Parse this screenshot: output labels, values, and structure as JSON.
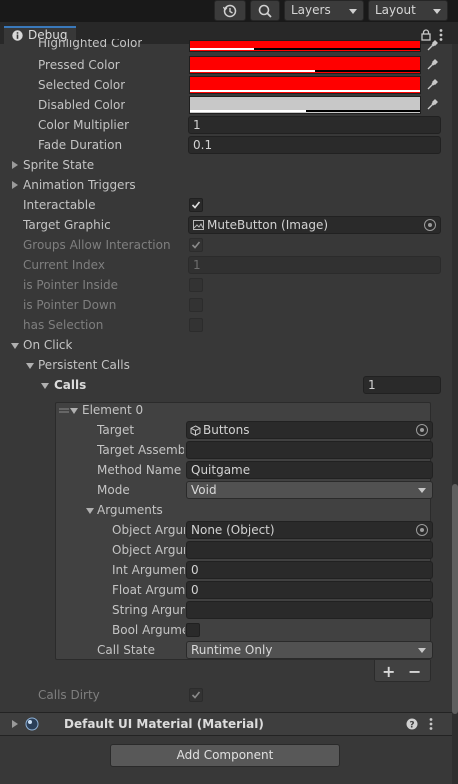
{
  "toolbar": {
    "layers_label": "Layers",
    "layout_label": "Layout"
  },
  "tab": {
    "title": "Debug"
  },
  "colors": {
    "pressed": "#ff0000",
    "selected": "#ff0000",
    "highlighted": "#ff0000",
    "disabled": "#c8c8c8",
    "accent": "#3a79bb"
  },
  "fields": {
    "highlighted_color": "Highlighted Color",
    "pressed_color": "Pressed Color",
    "selected_color": "Selected Color",
    "disabled_color": "Disabled Color",
    "color_multiplier_label": "Color Multiplier",
    "color_multiplier_value": "1",
    "fade_duration_label": "Fade Duration",
    "fade_duration_value": "0.1",
    "sprite_state": "Sprite State",
    "animation_triggers": "Animation Triggers",
    "interactable": "Interactable",
    "target_graphic_label": "Target Graphic",
    "target_graphic_value": "MuteButton (Image)",
    "groups_allow_interaction": "Groups Allow Interaction",
    "current_index_label": "Current Index",
    "current_index_value": "1",
    "is_pointer_inside": "is Pointer Inside",
    "is_pointer_down": "is Pointer Down",
    "has_selection": "has Selection",
    "on_click": "On Click",
    "persistent_calls": "Persistent Calls",
    "calls_label": "Calls",
    "calls_value": "1",
    "calls_dirty": "Calls Dirty"
  },
  "element": {
    "title": "Element 0",
    "target_label": "Target",
    "target_value": "Buttons",
    "target_assembly_label": "Target Assembl",
    "target_assembly_value": "",
    "method_name_label": "Method Name",
    "method_name_value": "Quitgame",
    "mode_label": "Mode",
    "mode_value": "Void",
    "arguments_label": "Arguments",
    "object_argument_label": "Object Argun",
    "object_argument_value": "None (Object)",
    "object_argument2_label": "Object Argun",
    "object_argument2_value": "",
    "int_argument_label": "Int Argument",
    "int_argument_value": "0",
    "float_argument_label": "Float Argume",
    "float_argument_value": "0",
    "string_argument_label": "String Argum",
    "string_argument_value": "",
    "bool_argument_label": "Bool Argume",
    "call_state_label": "Call State",
    "call_state_value": "Runtime Only",
    "add_label": "+",
    "remove_label": "−"
  },
  "material": {
    "title": "Default UI Material (Material)"
  },
  "add_component_label": "Add Component",
  "icons": {
    "history": "history-icon",
    "search": "search-icon",
    "info": "info-icon",
    "lock": "lock-icon",
    "more": "more-vert-icon",
    "eyedropper": "eyedropper-icon",
    "object_picker": "object-picker-icon",
    "help": "help-icon",
    "material_sphere": "material-sphere-icon"
  }
}
